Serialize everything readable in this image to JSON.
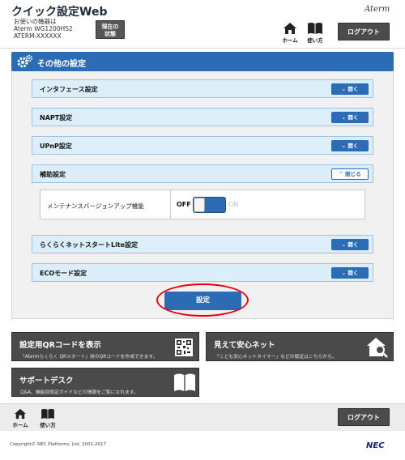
{
  "header": {
    "app_title": "クイック設定Web",
    "device_caption": "お使いの機器は",
    "device_model": "Aterm WG1200HS2",
    "device_ssid": "ATERM-XXXXXX",
    "status_button_line1": "現在の",
    "status_button_line2": "状態",
    "brand": "Aterm",
    "home_label": "ホーム",
    "guide_label": "使い方",
    "logout_label": "ログアウト"
  },
  "section": {
    "title": "その他の設定"
  },
  "settings_rows": [
    {
      "label": "インタフェース設定",
      "button": "開く"
    },
    {
      "label": "NAPT設定",
      "button": "開く"
    },
    {
      "label": "UPnP設定",
      "button": "開く"
    },
    {
      "label": "補助設定",
      "button": "閉じる"
    },
    {
      "label": "らくらくネットスタートLite設定",
      "button": "開く"
    },
    {
      "label": "ECOモード設定",
      "button": "開く"
    }
  ],
  "maintenance": {
    "label": "メンテナンスバージョンアップ機能",
    "off_label": "OFF",
    "on_label": "ON",
    "state": "OFF"
  },
  "apply_button": "設定",
  "tiles": {
    "qr": {
      "title": "設定用QRコードを表示",
      "desc": "「Atermらくらく QRスタート」用のQRコードを作成できます。"
    },
    "safety": {
      "title": "見えて安心ネット",
      "desc": "「こども安心ネットタイマー」などの設定はこちらから。"
    },
    "support": {
      "title": "サポートデスク",
      "desc": "Q&A、機能別設定ガイドなどの情報をご覧になれます。"
    }
  },
  "footer": {
    "home_label": "ホーム",
    "guide_label": "使い方",
    "logout_label": "ログアウト",
    "copyright": "Copyright© NEC Platforms, Ltd. 2001-2017",
    "vendor": "NEC"
  },
  "colors": {
    "accent": "#2b6cb5",
    "highlight_ring": "#e60012",
    "tile_background": "#4a4a4a"
  }
}
